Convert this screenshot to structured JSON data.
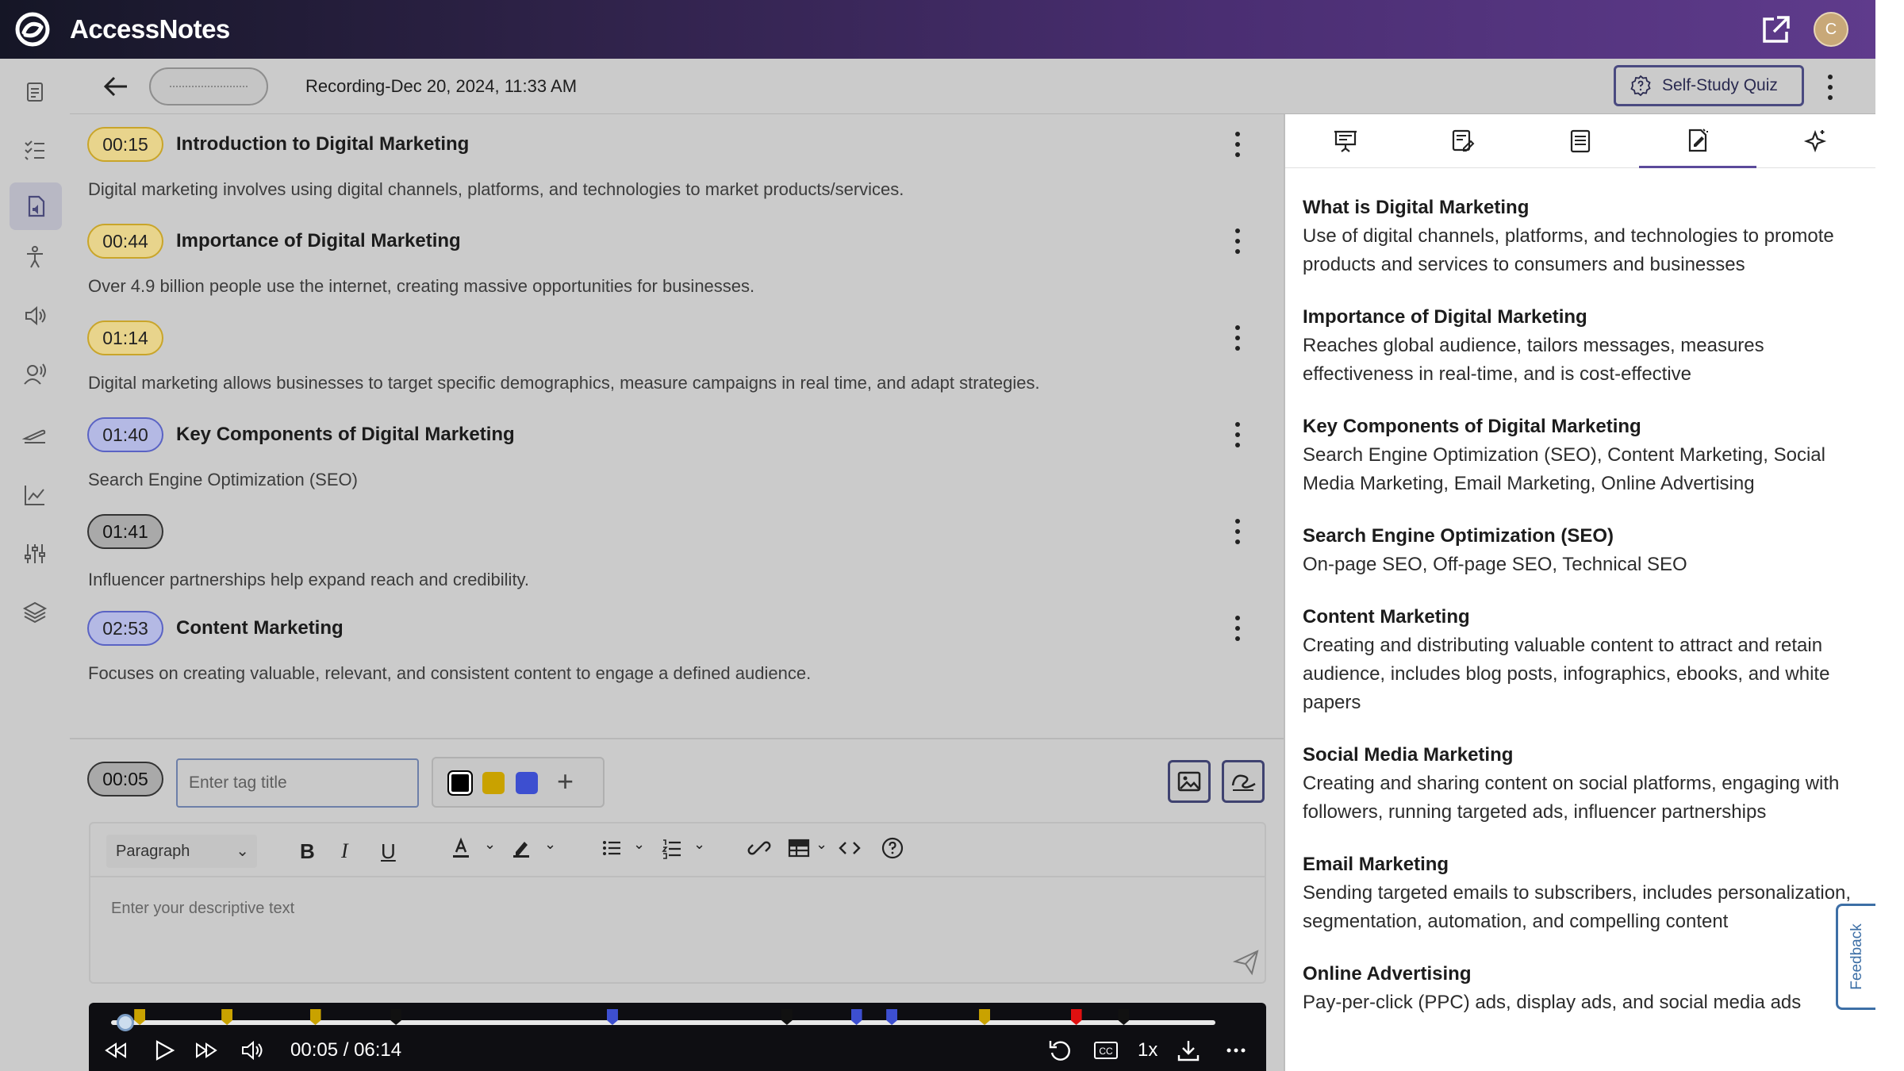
{
  "app": {
    "name": "AccessNotes",
    "avatar_initial": "C"
  },
  "header": {
    "recording_title": "Recording-Dec 20, 2024, 11:33 AM",
    "quiz_label": "Self-Study Quiz"
  },
  "sidebar": {
    "icons": [
      "notes-icon",
      "checklist-icon",
      "audio-file-icon",
      "accessibility-icon",
      "speaker-icon",
      "voice-user-icon",
      "plane-icon",
      "chart-icon",
      "sliders-icon",
      "layers-icon"
    ],
    "active_index": 2
  },
  "transcript": [
    {
      "time": "00:15",
      "color": "yellow",
      "title": "Introduction to Digital Marketing",
      "text": "Digital marketing involves using digital channels, platforms, and technologies to market products/services."
    },
    {
      "time": "00:44",
      "color": "yellow",
      "title": "Importance of Digital Marketing",
      "text": "Over 4.9 billion people use the internet, creating massive opportunities for businesses."
    },
    {
      "time": "01:14",
      "color": "yellow",
      "title": "",
      "text": "Digital marketing allows businesses to target specific demographics, measure campaigns in real time, and adapt strategies."
    },
    {
      "time": "01:40",
      "color": "blue",
      "title": "Key Components of Digital Marketing",
      "text": "Search Engine Optimization (SEO)"
    },
    {
      "time": "01:41",
      "color": "black",
      "title": "",
      "text": "Influencer partnerships help expand reach and credibility."
    },
    {
      "time": "02:53",
      "color": "blue",
      "title": "Content Marketing",
      "text": "Focuses on creating valuable, relevant, and consistent content to engage a defined audience."
    }
  ],
  "composer": {
    "current_time": "00:05",
    "tag_placeholder": "Enter tag title",
    "colors": [
      "#000000",
      "#c9a200",
      "#3d4fd0"
    ],
    "paragraph_label": "Paragraph",
    "editor_placeholder": "Enter your descriptive text"
  },
  "player": {
    "time_display": "00:05 / 06:14",
    "speed": "1x",
    "progress": 0.013,
    "markers": [
      {
        "pos": 0.026,
        "color": "#c9a200"
      },
      {
        "pos": 0.105,
        "color": "#c9a200"
      },
      {
        "pos": 0.185,
        "color": "#c9a200"
      },
      {
        "pos": 0.258,
        "color": "#111111"
      },
      {
        "pos": 0.454,
        "color": "#3d4fd0"
      },
      {
        "pos": 0.612,
        "color": "#111111"
      },
      {
        "pos": 0.675,
        "color": "#3d4fd0"
      },
      {
        "pos": 0.707,
        "color": "#3d4fd0"
      },
      {
        "pos": 0.791,
        "color": "#c9a200"
      },
      {
        "pos": 0.874,
        "color": "#e01010"
      },
      {
        "pos": 0.917,
        "color": "#111111"
      }
    ]
  },
  "right_panel": {
    "tabs": [
      "presentation-icon",
      "edit-document-icon",
      "document-icon",
      "summary-icon",
      "ai-sparkle-icon"
    ],
    "active_tab": 3,
    "notes": [
      {
        "heading": "What is Digital Marketing",
        "body": "Use of digital channels, platforms, and technologies to promote products and services to consumers and businesses"
      },
      {
        "heading": "Importance of Digital Marketing",
        "body": "Reaches global audience, tailors messages, measures effectiveness in real-time, and is cost-effective"
      },
      {
        "heading": "Key Components of Digital Marketing",
        "body": "Search Engine Optimization (SEO), Content Marketing, Social Media Marketing, Email Marketing, Online Advertising"
      },
      {
        "heading": "Search Engine Optimization (SEO)",
        "body": "On-page SEO, Off-page SEO, Technical SEO"
      },
      {
        "heading": "Content Marketing",
        "body": "Creating and distributing valuable content to attract and retain audience, includes blog posts, infographics, ebooks, and white papers"
      },
      {
        "heading": "Social Media Marketing",
        "body": "Creating and sharing content on social platforms, engaging with followers, running targeted ads, influencer partnerships"
      },
      {
        "heading": "Email Marketing",
        "body": "Sending targeted emails to subscribers, includes personalization, segmentation, automation, and compelling content"
      },
      {
        "heading": "Online Advertising",
        "body": "Pay-per-click (PPC) ads, display ads, and social media ads"
      }
    ]
  },
  "feedback_label": "Feedback"
}
